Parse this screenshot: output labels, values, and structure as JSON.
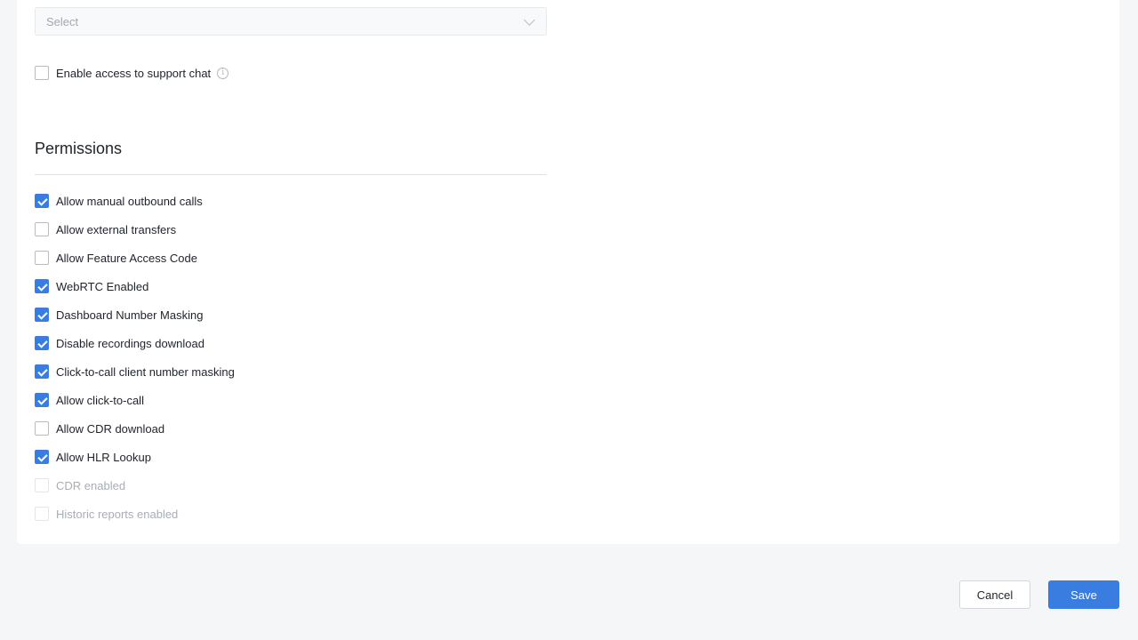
{
  "language_select": {
    "placeholder": "Select"
  },
  "support_chat": {
    "label": "Enable access to support chat",
    "checked": false
  },
  "permissions": {
    "title": "Permissions",
    "items": [
      {
        "label": "Allow manual outbound calls",
        "checked": true,
        "disabled": false
      },
      {
        "label": "Allow external transfers",
        "checked": false,
        "disabled": false
      },
      {
        "label": "Allow Feature Access Code",
        "checked": false,
        "disabled": false
      },
      {
        "label": "WebRTC Enabled",
        "checked": true,
        "disabled": false
      },
      {
        "label": "Dashboard Number Masking",
        "checked": true,
        "disabled": false
      },
      {
        "label": "Disable recordings download",
        "checked": true,
        "disabled": false
      },
      {
        "label": "Click-to-call client number masking",
        "checked": true,
        "disabled": false
      },
      {
        "label": "Allow click-to-call",
        "checked": true,
        "disabled": false
      },
      {
        "label": "Allow CDR download",
        "checked": false,
        "disabled": false
      },
      {
        "label": "Allow HLR Lookup",
        "checked": true,
        "disabled": false
      },
      {
        "label": "CDR enabled",
        "checked": false,
        "disabled": true
      },
      {
        "label": "Historic reports enabled",
        "checked": false,
        "disabled": true
      }
    ]
  },
  "footer": {
    "cancel_label": "Cancel",
    "save_label": "Save"
  },
  "colors": {
    "accent": "#3a7de0",
    "background": "#f5f6f8"
  }
}
